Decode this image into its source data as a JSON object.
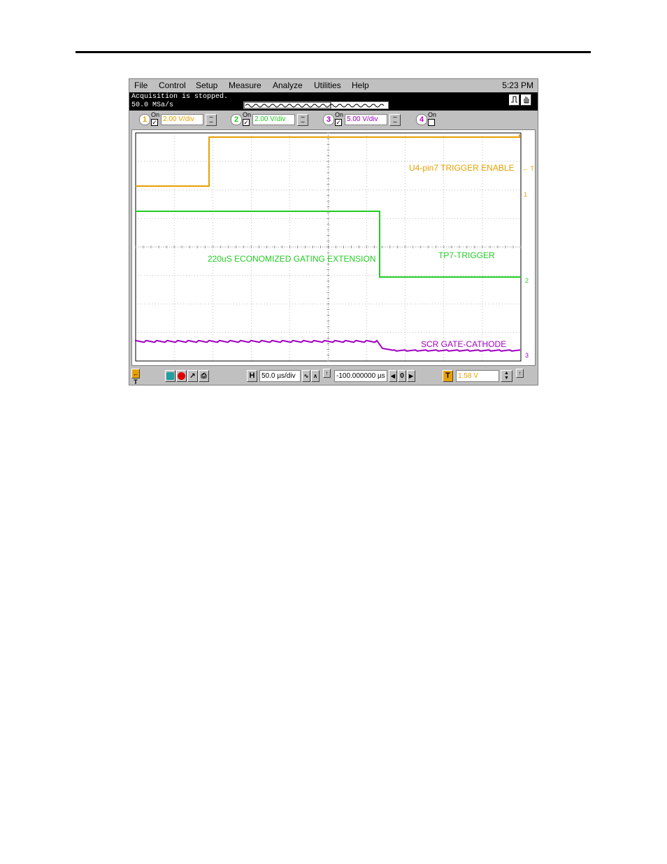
{
  "menu": {
    "items": [
      {
        "label": "File"
      },
      {
        "label": "Control"
      },
      {
        "label": "Setup"
      },
      {
        "label": "Measure"
      },
      {
        "label": "Analyze"
      },
      {
        "label": "Utilities"
      },
      {
        "label": "Help"
      }
    ],
    "clock": "5:23 PM"
  },
  "status": {
    "line1": "Acquisition is stopped.",
    "line2": "50.0 MSa/s"
  },
  "channels": [
    {
      "number": "1",
      "on_label": "On",
      "checked": true,
      "scale": "2.00 V/div",
      "color": "#e8a000"
    },
    {
      "number": "2",
      "on_label": "On",
      "checked": true,
      "scale": "2.00 V/div",
      "color": "#22cc22"
    },
    {
      "number": "3",
      "on_label": "On",
      "checked": true,
      "scale": "5.00 V/div",
      "color": "#a000c0"
    },
    {
      "number": "4",
      "on_label": "On",
      "checked": false,
      "scale": "",
      "color": "#cc00cc"
    }
  ],
  "traces": {
    "ch1_label": "U4-pin7 TRIGGER ENABLE",
    "ch2_label": "TP7-TRIGGER",
    "ch2_annotation": "220uS ECONOMIZED GATING EXTENSION",
    "ch3_label": "SCR GATE-CATHODE",
    "marker_trigger": "← T",
    "marker_1": "1",
    "marker_2": "2",
    "marker_3": "3"
  },
  "timebase": {
    "h_label": "H",
    "scale": "50.0 µs/div",
    "delay": "-100.000000 µs",
    "zero_btn": "0",
    "trigger_label": "T",
    "trigger_level": "1.58 V"
  },
  "colors": {
    "ch1": "#e8a000",
    "ch2": "#22cc22",
    "ch3": "#a000c0",
    "grid": "#808080"
  }
}
